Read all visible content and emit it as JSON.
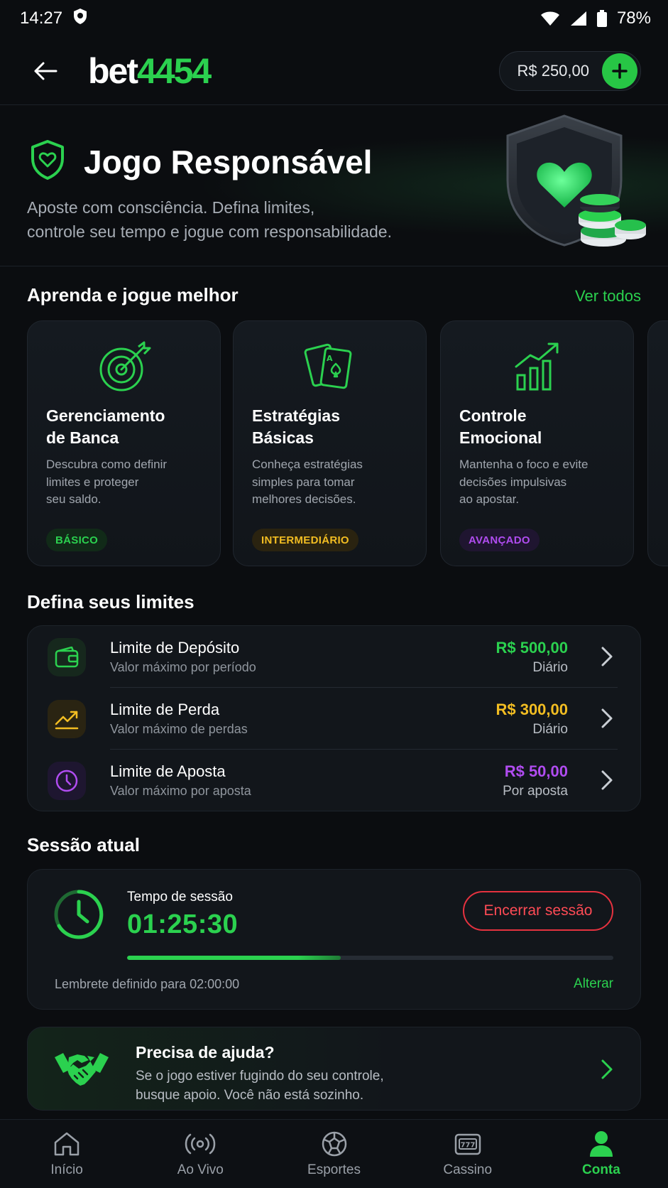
{
  "status_bar": {
    "time": "14:27",
    "battery": "78%"
  },
  "header": {
    "logo_text_1": "bet",
    "logo_text_2": "4454",
    "balance": "R$ 250,00"
  },
  "hero": {
    "title": "Jogo Responsável",
    "subtitle_line1": "Aposte com consciência. Defina limites,",
    "subtitle_line2": "controle seu tempo e jogue com responsabilidade."
  },
  "learn": {
    "title": "Aprenda e jogue melhor",
    "see_all": "Ver todos",
    "cards": [
      {
        "title_1": "Gerenciamento",
        "title_2": "de Banca",
        "desc_1": "Descubra como definir",
        "desc_2": "limites e proteger",
        "desc_3": "seu saldo.",
        "badge": "BÁSICO",
        "icon": "target-icon",
        "color": "#2bd14f"
      },
      {
        "title_1": "Estratégias",
        "title_2": "Básicas",
        "desc_1": "Conheça estratégias",
        "desc_2": "simples para tomar",
        "desc_3": "melhores decisões.",
        "badge": "INTERMEDIÁRIO",
        "icon": "cards-icon",
        "color": "#f2bd22"
      },
      {
        "title_1": "Controle",
        "title_2": "Emocional",
        "desc_1": "Mantenha o foco e evite",
        "desc_2": "decisões impulsivas",
        "desc_3": "ao apostar.",
        "badge": "AVANÇADO",
        "icon": "chart-growth-icon",
        "color": "#b04cf0"
      }
    ]
  },
  "limits": {
    "title": "Defina seus limites",
    "items": [
      {
        "name": "Limite de Depósito",
        "desc": "Valor máximo por período",
        "amount": "R$ 500,00",
        "period": "Diário",
        "color": "#2bd14f",
        "icon": "wallet-icon"
      },
      {
        "name": "Limite de Perda",
        "desc": "Valor máximo de perdas",
        "amount": "R$ 300,00",
        "period": "Diário",
        "color": "#f2bd22",
        "icon": "trend-icon"
      },
      {
        "name": "Limite de Aposta",
        "desc": "Valor máximo por aposta",
        "amount": "R$ 50,00",
        "period": "Por aposta",
        "color": "#b04cf0",
        "icon": "clock-icon"
      }
    ]
  },
  "session": {
    "title": "Sessão atual",
    "label": "Tempo de sessão",
    "time": "01:25:30",
    "end_button": "Encerrar sessão",
    "progress_fraction": 0.44,
    "reminder": "Lembrete definido para 02:00:00",
    "change": "Alterar"
  },
  "help": {
    "title": "Precisa de ajuda?",
    "desc_1": "Se o jogo estiver fugindo do seu controle,",
    "desc_2": "busque apoio. Você não está sozinho."
  },
  "nav": {
    "items": [
      {
        "label": "Início",
        "icon": "home-icon",
        "active": false
      },
      {
        "label": "Ao Vivo",
        "icon": "live-icon",
        "active": false
      },
      {
        "label": "Esportes",
        "icon": "soccer-ball-icon",
        "active": false
      },
      {
        "label": "Cassino",
        "icon": "slot-machine-icon",
        "active": false
      },
      {
        "label": "Conta",
        "icon": "user-icon",
        "active": true
      }
    ]
  }
}
